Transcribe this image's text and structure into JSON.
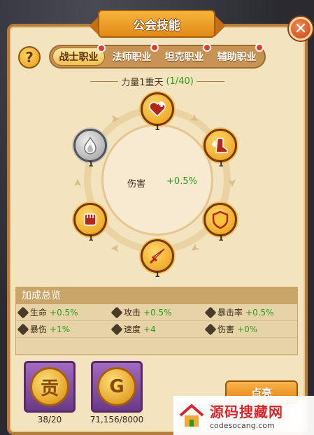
{
  "window": {
    "title": "公会技能",
    "close_icon": "close-icon",
    "help_label": "?"
  },
  "tabs": [
    {
      "label": "战士职业",
      "active": true,
      "has_badge": true
    },
    {
      "label": "法师职业",
      "active": false,
      "has_badge": true
    },
    {
      "label": "坦克职业",
      "active": false,
      "has_badge": true
    },
    {
      "label": "辅助职业",
      "active": false,
      "has_badge": true
    }
  ],
  "skill_header": {
    "name": "力量1重天",
    "progress": "(1/40)"
  },
  "wheel": {
    "center": {
      "stat_name": "伤害",
      "stat_value": "+0.5%"
    },
    "nodes": [
      {
        "icon": "heart-plus-icon",
        "level": "1",
        "locked": false
      },
      {
        "icon": "boot-plus-icon",
        "level": "1",
        "locked": false
      },
      {
        "icon": "shield-icon",
        "level": "1",
        "locked": false
      },
      {
        "icon": "sword-icon",
        "level": "1",
        "locked": false
      },
      {
        "icon": "fist-icon",
        "level": "1",
        "locked": false
      },
      {
        "icon": "flame-icon",
        "level": "1",
        "locked": true
      }
    ]
  },
  "bonus": {
    "title": "加成总览",
    "rows": [
      [
        {
          "name": "生命",
          "value": "+0.5%"
        },
        {
          "name": "攻击",
          "value": "+0.5%"
        },
        {
          "name": "暴击率",
          "value": "+0.5%"
        }
      ],
      [
        {
          "name": "暴伤",
          "value": "+1%"
        },
        {
          "name": "速度",
          "value": "+4"
        },
        {
          "name": "伤害",
          "value": "+0%"
        }
      ]
    ]
  },
  "currencies": [
    {
      "icon": "contribution-coin-icon",
      "glyph": "贡",
      "amount": "38/20"
    },
    {
      "icon": "gold-coin-icon",
      "glyph": "G",
      "amount": "71,156/8000"
    }
  ],
  "action": {
    "label": "点亮"
  },
  "watermark": {
    "title": "源码搜藏网",
    "url": "codesocang.com"
  },
  "colors": {
    "accent": "#e89a12",
    "positive": "#2f9a1a",
    "badge": "#e53b2a"
  }
}
